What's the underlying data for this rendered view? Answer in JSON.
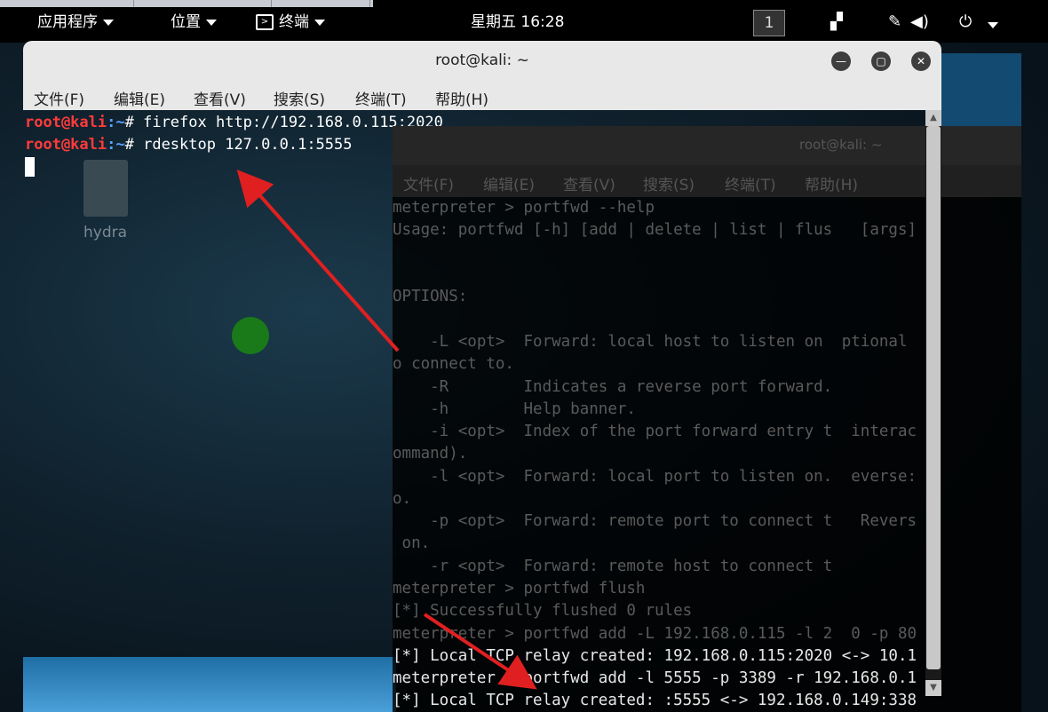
{
  "top_panel": {
    "apps_label": "应用程序",
    "places_label": "位置",
    "terminal_label": "终端",
    "clock": "星期五 16:28",
    "workspace": "1"
  },
  "window1": {
    "title": "root@kali: ~",
    "menu": [
      "文件(F)",
      "编辑(E)",
      "查看(V)",
      "搜索(S)",
      "终端(T)",
      "帮助(H)"
    ],
    "lines": [
      {
        "user": "root@kali",
        "path": ":~",
        "prompt_end": "# ",
        "cmd": "firefox http://192.168.0.115:2020"
      },
      {
        "user": "root@kali",
        "path": ":~",
        "prompt_end": "# ",
        "cmd": "rdesktop 127.0.0.1:5555"
      }
    ]
  },
  "desktop": {
    "icon_label": "hydra"
  },
  "window2": {
    "title": "root@kali: ~",
    "menu": [
      "文件(F)",
      "编辑(E)",
      "查看(V)",
      "搜索(S)",
      "终端(T)",
      "帮助(H)"
    ],
    "lines": [
      "meterpreter > portfwd --help",
      "Usage: portfwd [-h] [add | delete | list | flus   [args]",
      "",
      "",
      "OPTIONS:",
      "",
      "    -L <opt>  Forward: local host to listen on  ptional",
      "o connect to.",
      "    -R        Indicates a reverse port forward.",
      "    -h        Help banner.",
      "    -i <opt>  Index of the port forward entry t  interac",
      "ommand).",
      "    -l <opt>  Forward: local port to listen on.  everse:",
      "o.",
      "    -p <opt>  Forward: remote port to connect t   Revers",
      " on.",
      "    -r <opt>  Forward: remote host to connect t",
      "meterpreter > portfwd flush",
      "[*] Successfully flushed 0 rules",
      "meterpreter > portfwd add -L 192.168.0.115 -l 2  0 -p 80",
      "[*] Local TCP relay created: 192.168.0.115:2020 <-> 10.1",
      "meterpreter > portfwd add -l 5555 -p 3389 -r 192.168.0.1",
      "[*] Local TCP relay created: :5555 <-> 192.168.0.149:338"
    ]
  },
  "colors": {
    "panel_bg": "#000000",
    "prompt_user": "#ff3b3b",
    "prompt_path": "#5aa0ff",
    "arrow": "#e02020",
    "titlebar": "#e8e8e8"
  }
}
